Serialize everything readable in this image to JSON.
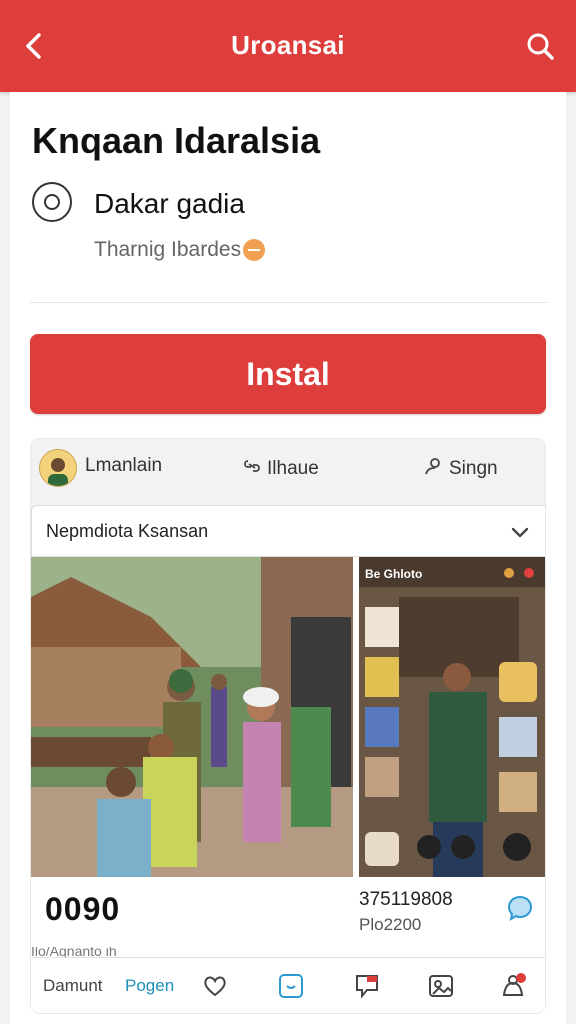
{
  "header": {
    "title": "Uroansai",
    "back_icon": "back-arrow-icon",
    "search_icon": "search-icon",
    "color": "#dd3e3b"
  },
  "app": {
    "name": "Knqaan Idaralsia",
    "developer": "Dakar gadia",
    "subline": "Tharnig Ibardes",
    "developer_icon": "developer-circle-icon"
  },
  "install": {
    "label": "Instal",
    "color": "#dd3e3b"
  },
  "tabs": [
    {
      "label": "Lmanlain",
      "icon": "avatar"
    },
    {
      "label": "Ilhaue",
      "icon": "link-icon"
    },
    {
      "label": "Singn",
      "icon": "person-icon"
    }
  ],
  "dropdown": {
    "value": "Nepmdiota Ksansan"
  },
  "screenshot_overlay": {
    "label": "Be Ghloto"
  },
  "stats": {
    "count": "0090",
    "number": "375119808",
    "sub": "Plo2200",
    "truncated_text": "Ilo/Agnanto ih"
  },
  "bottom": {
    "label1": "Damunt",
    "label2": "Pogen",
    "icons": [
      "heart-icon",
      "chat-square-icon",
      "comment-flag-icon",
      "image-person-icon",
      "notification-person-icon"
    ],
    "badge_count": ""
  }
}
